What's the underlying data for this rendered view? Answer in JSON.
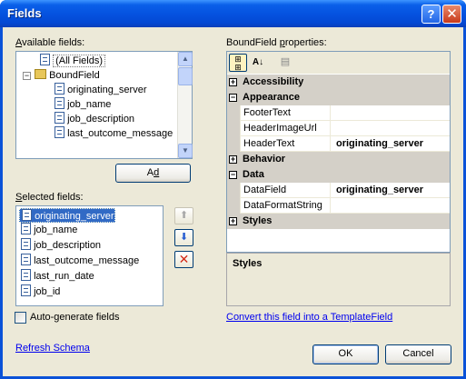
{
  "window": {
    "title": "Fields",
    "help_glyph": "?",
    "close_glyph": "✕"
  },
  "available": {
    "label_prefix": "",
    "label_accesskey": "A",
    "label_rest": "vailable fields:",
    "items": [
      {
        "label": "(All Fields)",
        "icon": "document-icon"
      },
      {
        "label": "BoundField",
        "icon": "folder-icon"
      },
      {
        "label": "originating_server",
        "icon": "document-icon"
      },
      {
        "label": "job_name",
        "icon": "document-icon"
      },
      {
        "label": "job_description",
        "icon": "document-icon"
      },
      {
        "label": "last_outcome_message",
        "icon": "document-icon"
      }
    ]
  },
  "add_button": {
    "accesskey": "d",
    "pre": "A",
    "post": "d"
  },
  "selected": {
    "label_pre": "",
    "label_accesskey": "S",
    "label_rest": "elected fields:",
    "items": [
      {
        "label": "originating_server",
        "selected": true
      },
      {
        "label": "job_name"
      },
      {
        "label": "job_description"
      },
      {
        "label": "last_outcome_message"
      },
      {
        "label": "last_run_date"
      },
      {
        "label": "job_id"
      }
    ]
  },
  "autogen": {
    "label": "Auto-generate fields",
    "checked": false
  },
  "refresh_link": "Refresh Schema",
  "properties": {
    "label_pre": "BoundField ",
    "label_accesskey": "p",
    "label_rest": "roperties:",
    "rows": [
      {
        "kind": "category",
        "name": "Accessibility",
        "expanded": false
      },
      {
        "kind": "category",
        "name": "Appearance",
        "expanded": true
      },
      {
        "kind": "property",
        "name": "FooterText",
        "value": ""
      },
      {
        "kind": "property",
        "name": "HeaderImageUrl",
        "value": ""
      },
      {
        "kind": "property",
        "name": "HeaderText",
        "value": "originating_server"
      },
      {
        "kind": "category",
        "name": "Behavior",
        "expanded": false
      },
      {
        "kind": "category",
        "name": "Data",
        "expanded": true
      },
      {
        "kind": "property",
        "name": "DataField",
        "value": "originating_server"
      },
      {
        "kind": "property",
        "name": "DataFormatString",
        "value": ""
      },
      {
        "kind": "category",
        "name": "Styles",
        "expanded": false
      }
    ],
    "description_title": "Styles"
  },
  "convert_link": "Convert this field into a TemplateField",
  "ok_button": "OK",
  "cancel_button": "Cancel",
  "plus_glyph": "+",
  "minus_glyph": "−"
}
